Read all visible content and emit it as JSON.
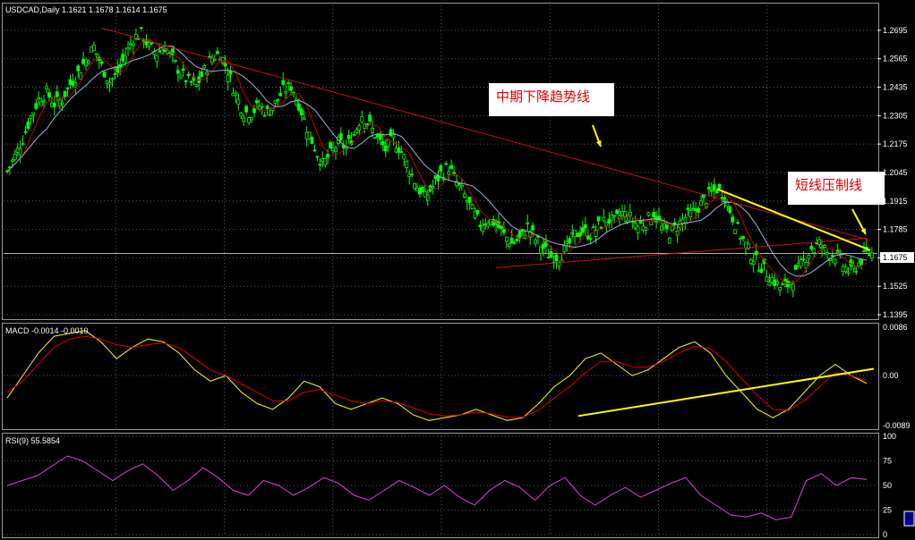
{
  "panels": {
    "price": {
      "header": "USDCAD,Daily  1.1621 1.1678 1.1614 1.1675",
      "ticks": [
        "1.2695",
        "1.2565",
        "1.2435",
        "1.2305",
        "1.2175",
        "1.2045",
        "1.1915",
        "1.1785",
        "1.1655",
        "1.1525",
        "1.1395"
      ],
      "current_label": "1.1675",
      "overlap_label": "1.1655"
    },
    "macd": {
      "header": "MACD  -0.0014 -0.0010",
      "ticks": [
        "0.0086",
        "0.00",
        "-0.0089"
      ]
    },
    "rsi": {
      "header": "RSI(9)  55.5854",
      "ticks": [
        "100",
        "75",
        "50",
        "25",
        "0"
      ]
    }
  },
  "annotations": {
    "mid_trend": "中期下降趋势线",
    "short_resist": "短线压制线"
  },
  "colors": {
    "background": "#000000",
    "candles": "#00ff00",
    "ma_fast": "#c80000",
    "ma_slow": "#9ab0d8",
    "trendline_red": "#d01010",
    "trendline_yellow": "#ffff00",
    "macd_main": "#ffff00",
    "macd_signal": "#e00000",
    "rsi": "#e040e0",
    "grid": "#8080a0"
  },
  "chart_data": [
    {
      "type": "line",
      "title": "USDCAD,Daily",
      "ohlc_last": {
        "open": 1.1621,
        "high": 1.1678,
        "low": 1.1614,
        "close": 1.1675
      },
      "ylim": [
        1.1395,
        1.276
      ],
      "y_ticks": [
        1.2695,
        1.2565,
        1.2435,
        1.2305,
        1.2175,
        1.2045,
        1.1915,
        1.1785,
        1.1655,
        1.1525,
        1.1395
      ],
      "grid": true,
      "series": [
        {
          "values": [
            1.205,
            1.212,
            1.22,
            1.23,
            1.238,
            1.241,
            1.236,
            1.238,
            1.245,
            1.25,
            1.256,
            1.262,
            1.253,
            1.246,
            1.25,
            1.258,
            1.266,
            1.268,
            1.262,
            1.259,
            1.262,
            1.256,
            1.25,
            1.246,
            1.244,
            1.251,
            1.257,
            1.259,
            1.251,
            1.24,
            1.232,
            1.232,
            1.235,
            1.232,
            1.236,
            1.242,
            1.244,
            1.236,
            1.225,
            1.216,
            1.208,
            1.213,
            1.218,
            1.216,
            1.222,
            1.231,
            1.226,
            1.22,
            1.215,
            1.22,
            1.214,
            1.206,
            1.198,
            1.193,
            1.198,
            1.204,
            1.207,
            1.2,
            1.194,
            1.187,
            1.181,
            1.183,
            1.181,
            1.176,
            1.172,
            1.174,
            1.18,
            1.174,
            1.17,
            1.166,
            1.166,
            1.17,
            1.176,
            1.178,
            1.176,
            1.18,
            1.183,
            1.182,
            1.186,
            1.184,
            1.18,
            1.182,
            1.186,
            1.179,
            1.177,
            1.18,
            1.184,
            1.186,
            1.19,
            1.194,
            1.197,
            1.194,
            1.184,
            1.176,
            1.169,
            1.164,
            1.16,
            1.156,
            1.152,
            1.153,
            1.158,
            1.164,
            1.17,
            1.172,
            1.168,
            1.167,
            1.162,
            1.159,
            1.163,
            1.1675
          ]
        }
      ]
    },
    {
      "type": "line",
      "title": "MACD",
      "ylim": [
        -0.0089,
        0.0086
      ],
      "y_ticks": [
        0.0086,
        0.0,
        -0.0089
      ],
      "series": [
        {
          "values": [
            -0.004,
            0.0,
            0.004,
            0.007,
            0.0075,
            0.008,
            0.006,
            0.003,
            0.005,
            0.0065,
            0.006,
            0.004,
            0.001,
            -0.001,
            0.0,
            -0.003,
            -0.005,
            -0.006,
            -0.004,
            -0.001,
            -0.002,
            -0.005,
            -0.006,
            -0.005,
            -0.004,
            -0.005,
            -0.007,
            -0.008,
            -0.0075,
            -0.007,
            -0.006,
            -0.007,
            -0.008,
            -0.0075,
            -0.005,
            -0.002,
            0.0,
            0.003,
            0.004,
            0.002,
            0.0,
            0.001,
            0.003,
            0.005,
            0.006,
            0.004,
            0.0,
            -0.003,
            -0.006,
            -0.0075,
            -0.006,
            -0.003,
            0.0,
            0.002,
            0.0,
            -0.0014
          ]
        },
        {
          "values": [
            -0.003,
            -0.001,
            0.002,
            0.005,
            0.0065,
            0.007,
            0.0065,
            0.0055,
            0.005,
            0.0055,
            0.0058,
            0.005,
            0.003,
            0.001,
            0.0,
            -0.0015,
            -0.003,
            -0.0045,
            -0.0045,
            -0.003,
            -0.0025,
            -0.0035,
            -0.0045,
            -0.005,
            -0.0045,
            -0.0048,
            -0.0058,
            -0.0068,
            -0.0072,
            -0.007,
            -0.0065,
            -0.0068,
            -0.0074,
            -0.0074,
            -0.0062,
            -0.004,
            -0.002,
            0.0005,
            0.0025,
            0.0025,
            0.0015,
            0.0015,
            0.0025,
            0.004,
            0.0052,
            0.0048,
            0.0025,
            -0.0005,
            -0.0035,
            -0.006,
            -0.0062,
            -0.0045,
            -0.002,
            0.0005,
            0.0,
            -0.001
          ]
        }
      ]
    },
    {
      "type": "line",
      "title": "RSI(9)",
      "ylim": [
        0,
        100
      ],
      "y_ticks": [
        100,
        75,
        50,
        25,
        0
      ],
      "series": [
        {
          "values": [
            50,
            55,
            60,
            70,
            80,
            75,
            65,
            55,
            65,
            72,
            60,
            45,
            55,
            68,
            58,
            45,
            40,
            55,
            50,
            40,
            48,
            58,
            52,
            40,
            35,
            45,
            55,
            48,
            40,
            50,
            38,
            30,
            45,
            55,
            48,
            35,
            50,
            58,
            40,
            30,
            40,
            48,
            38,
            45,
            52,
            58,
            40,
            30,
            20,
            18,
            22,
            15,
            18,
            55,
            62,
            50,
            58,
            56
          ]
        }
      ]
    }
  ]
}
